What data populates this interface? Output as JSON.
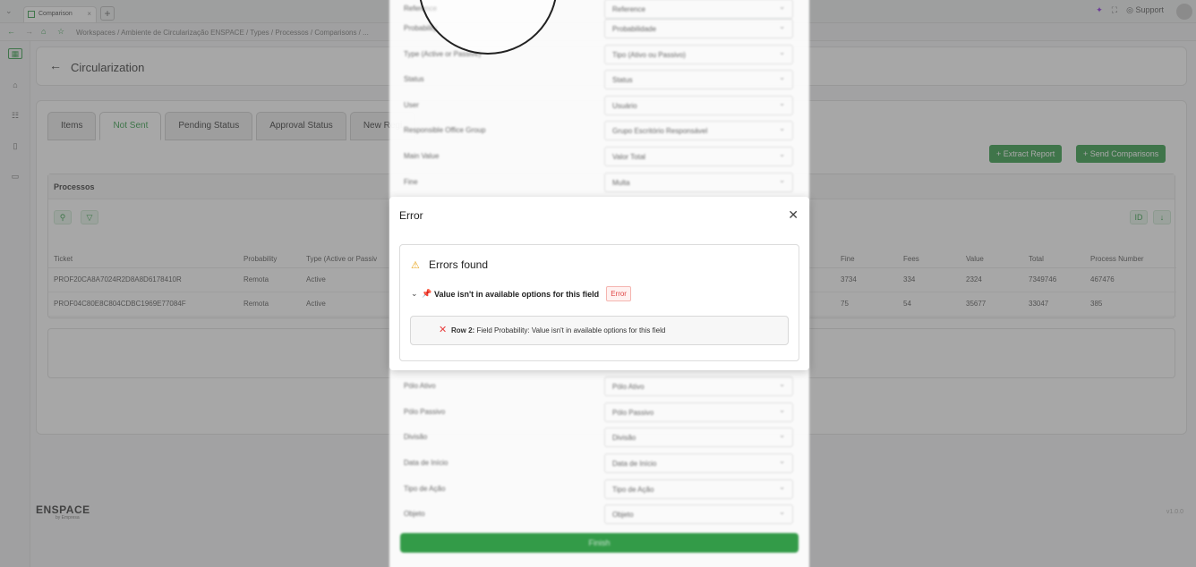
{
  "browser": {
    "tab_label": "Comparison",
    "new_tab": "+",
    "support_label": "Support",
    "breadcrumb": "Workspaces / Ambiente de Circularização ENSPACE / Types / Processos / Comparisons / ..."
  },
  "header": {
    "title": "Circularization"
  },
  "tabs": [
    "Items",
    "Not Sent",
    "Pending Status",
    "Approval Status",
    "New Regi"
  ],
  "actions": {
    "extract_report": "Extract Report",
    "send_comparisons": "Send Comparisons"
  },
  "processos": {
    "title": "Processos",
    "columns_left": [
      "Ticket",
      "Probability",
      "Type (Active or Passiv"
    ],
    "columns_right": [
      "Fine",
      "Fees",
      "Value",
      "Total",
      "Process Number"
    ],
    "rows": [
      {
        "ticket": "PROF20CA8A7024R2D8A8D6178410R",
        "probability": "Remota",
        "type": "Active",
        "fine": "3734",
        "fees": "334",
        "value": "2324",
        "total": "7349746",
        "process_number": "467476"
      },
      {
        "ticket": "PROF04C80E8C804CDBC1969E77084F",
        "probability": "Remota",
        "type": "Active",
        "fine": "75",
        "fees": "54",
        "value": "35677",
        "total": "33047",
        "process_number": "385"
      }
    ]
  },
  "drawer": {
    "fields": [
      {
        "label": "Reference",
        "value": "Reference"
      },
      {
        "label": "Probability",
        "value": "Probabilidade"
      },
      {
        "label": "Type (Active or Passive)",
        "value": "Tipo (Ativo ou Passivo)"
      },
      {
        "label": "Status",
        "value": "Status"
      },
      {
        "label": "User",
        "value": "Usuário"
      },
      {
        "label": "Responsible Office Group",
        "value": "Grupo Escritório Responsável"
      },
      {
        "label": "Main Value",
        "value": "Valor Total"
      },
      {
        "label": "Fine",
        "value": "Multa"
      }
    ],
    "fields_lower": [
      {
        "label": "Pólo Ativo",
        "value": "Pólo Ativo"
      },
      {
        "label": "Pólo Passivo",
        "value": "Pólo Passivo"
      },
      {
        "label": "Divisão",
        "value": "Divisão"
      },
      {
        "label": "Data de Início",
        "value": "Data de Início"
      },
      {
        "label": "Tipo de Ação",
        "value": "Tipo de Ação"
      },
      {
        "label": "Objeto",
        "value": "Objeto"
      }
    ],
    "finish": "Finish"
  },
  "modal": {
    "title": "Error",
    "errors_found": "Errors found",
    "error_message": "Value isn't in available options for this field",
    "badge": "Error",
    "detail_row": "Row 2:",
    "detail_text": "Field Probability: Value isn't in available options for this field"
  },
  "footer": {
    "logo": "ENSPACE",
    "logo_sub": "by Empresa",
    "version": "v1.0.0"
  },
  "colors": {
    "accent": "#2e9b44",
    "error": "#e04848",
    "warning": "#e8a317"
  }
}
